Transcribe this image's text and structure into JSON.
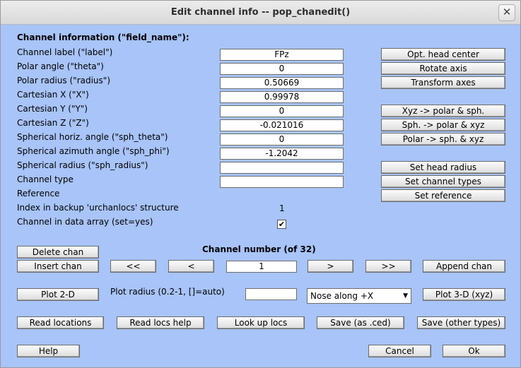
{
  "window": {
    "title": "Edit channel info -- pop_chanedit()",
    "close_glyph": "✕"
  },
  "channel_info": {
    "header": "Channel information (\"field_name\"):",
    "rows": [
      {
        "label": "Channel label (\"label\")",
        "value": "FPz"
      },
      {
        "label": "Polar angle (\"theta\")",
        "value": "0"
      },
      {
        "label": "Polar radius (\"radius\")",
        "value": "0.50669"
      },
      {
        "label": "Cartesian X (\"X\")",
        "value": "0.99978"
      },
      {
        "label": "Cartesian Y (\"Y\")",
        "value": "0"
      },
      {
        "label": "Cartesian Z (\"Z\")",
        "value": "-0.021016"
      },
      {
        "label": "Spherical horiz. angle (\"sph_theta\")",
        "value": "0"
      },
      {
        "label": "Spherical azimuth angle (\"sph_phi\")",
        "value": "-1.2042"
      },
      {
        "label": "Spherical radius (\"sph_radius\")",
        "value": ""
      },
      {
        "label": "Channel type",
        "value": ""
      },
      {
        "label": "Reference"
      },
      {
        "label": "Index in backup 'urchanlocs' structure",
        "value": "1"
      },
      {
        "label": "Channel in data array (set=yes)",
        "checked": "✔"
      }
    ]
  },
  "right_buttons": {
    "opt_head_center": "Opt. head center",
    "rotate_axis": "Rotate axis",
    "transform_axes": "Transform axes",
    "xyz_to_polar": "Xyz -> polar & sph.",
    "sph_to_polar": "Sph. -> polar & xyz",
    "polar_to_sph": "Polar -> sph. & xyz",
    "set_head_radius": "Set head radius",
    "set_channel_types": "Set channel types",
    "set_reference": "Set reference"
  },
  "navigation": {
    "delete_chan": "Delete chan",
    "insert_chan": "Insert chan",
    "channel_number_label": "Channel number (of 32)",
    "first": "<<",
    "prev": "<",
    "channel_number": "1",
    "next": ">",
    "last": ">>",
    "append_chan": "Append chan"
  },
  "plot": {
    "plot_2d": "Plot 2-D",
    "radius_label": "Plot radius (0.2-1, []=auto)",
    "radius_value": "",
    "nose_direction": "Nose along +X",
    "plot_3d": "Plot 3-D (xyz)"
  },
  "file_buttons": {
    "read_locations": "Read locations",
    "read_locs_help": "Read locs help",
    "look_up_locs": "Look up locs",
    "save_ced": "Save (as .ced)",
    "save_other": "Save (other types)"
  },
  "footer": {
    "help": "Help",
    "cancel": "Cancel",
    "ok": "Ok"
  }
}
